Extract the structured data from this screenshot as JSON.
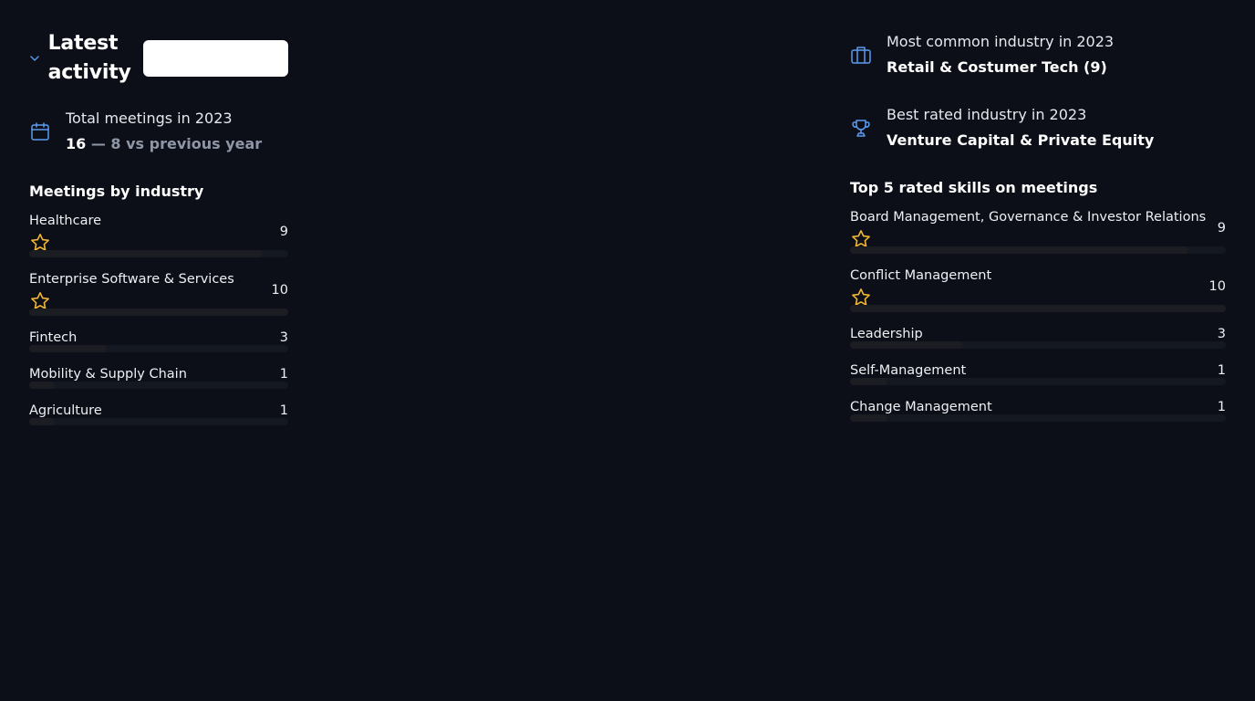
{
  "header": {
    "title": "Latest activity",
    "selector_value": ""
  },
  "total": {
    "label": "Total meetings in 2023",
    "value": "16",
    "delta": "— 8 vs previous year",
    "icon": "calendar-icon"
  },
  "industry_section": {
    "title": "Meetings by industry",
    "items": [
      {
        "name": "Healthcare",
        "count": "9",
        "starred": true,
        "fraction": 0.9
      },
      {
        "name": "Enterprise Software & Services",
        "count": "10",
        "starred": true,
        "fraction": 1.0
      },
      {
        "name": "Fintech",
        "count": "3",
        "starred": false,
        "fraction": 0.3
      },
      {
        "name": "Mobility & Supply Chain",
        "count": "1",
        "starred": false,
        "fraction": 0.1
      },
      {
        "name": "Agriculture",
        "count": "1",
        "starred": false,
        "fraction": 0.1
      }
    ]
  },
  "common_industry": {
    "label": "Most common industry in 2023",
    "value": "Retail & Costumer Tech (9)",
    "icon": "briefcase-icon"
  },
  "best_industry": {
    "label": "Best rated industry in 2023",
    "value": "Venture Capital & Private Equity",
    "icon": "trophy-icon"
  },
  "skills_section": {
    "title": "Top 5 rated skills on meetings",
    "items": [
      {
        "name": "Board Management, Governance & Investor Relations",
        "count": "9",
        "starred": true,
        "fraction": 0.9
      },
      {
        "name": "Conflict Management",
        "count": "10",
        "starred": true,
        "fraction": 1.0
      },
      {
        "name": "Leadership",
        "count": "3",
        "starred": false,
        "fraction": 0.3
      },
      {
        "name": "Self-Management",
        "count": "1",
        "starred": false,
        "fraction": 0.1
      },
      {
        "name": "Change Management",
        "count": "1",
        "starred": false,
        "fraction": 0.1
      }
    ]
  },
  "colors": {
    "background": "#0c0f18",
    "accent_icon": "#5b9bf0",
    "star": "#f2b630",
    "muted_text": "#8f97a6"
  }
}
